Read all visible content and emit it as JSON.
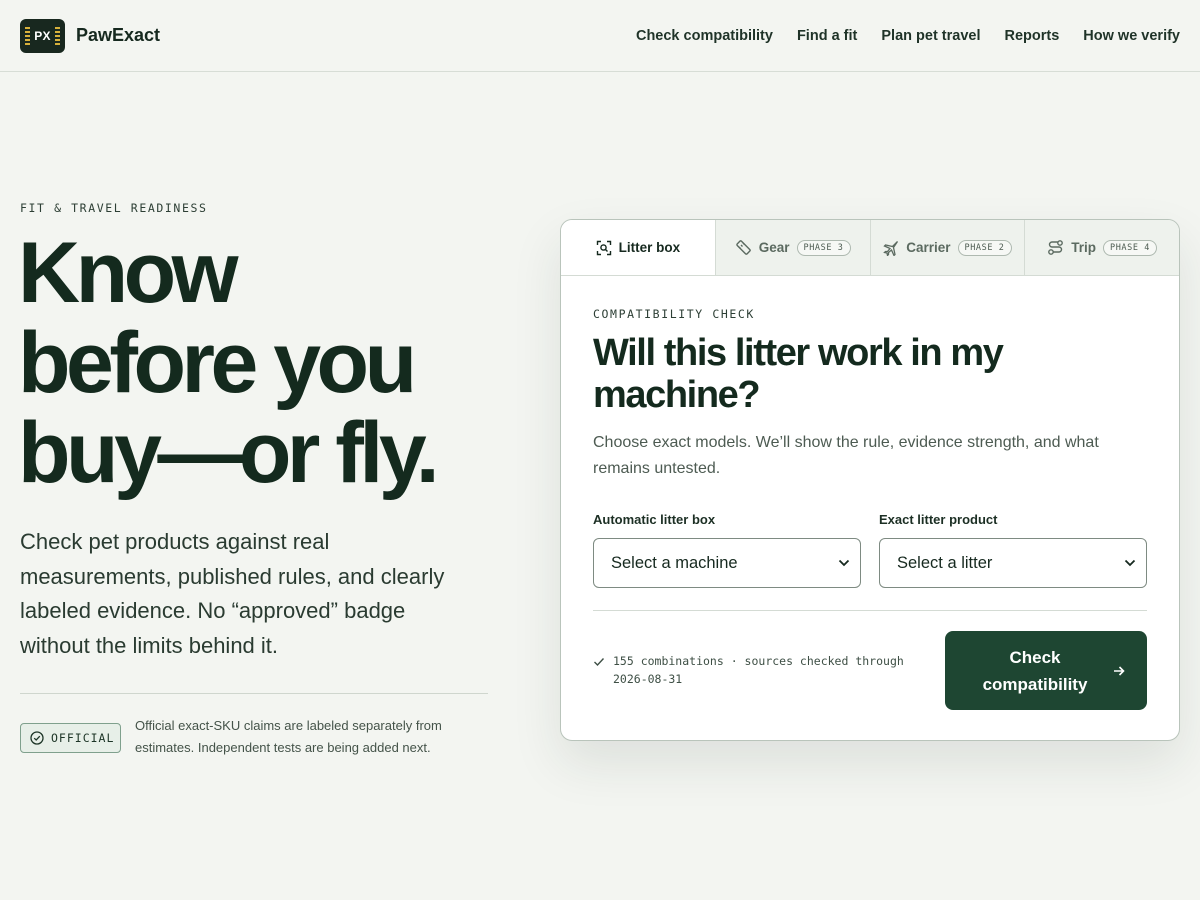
{
  "header": {
    "logo_text": "PX",
    "brand": "PawExact",
    "nav": [
      "Check compatibility",
      "Find a fit",
      "Plan pet travel",
      "Reports",
      "How we verify"
    ]
  },
  "hero": {
    "eyebrow": "FIT & TRAVEL READINESS",
    "title_lines": [
      "Know",
      "before you",
      "buy—or fly."
    ],
    "subtitle": "Check pet products against real measurements, published rules, and clearly labeled evidence. No “approved” badge without the limits behind it.",
    "badge": "OFFICIAL",
    "badge_note": "Official exact-SKU claims are labeled separately from estimates. Independent tests are being added next."
  },
  "card": {
    "tabs": [
      {
        "label": "Litter box",
        "phase": "",
        "icon": "scan-icon",
        "active": true
      },
      {
        "label": "Gear",
        "phase": "PHASE 3",
        "icon": "ruler-icon",
        "active": false
      },
      {
        "label": "Carrier",
        "phase": "PHASE 2",
        "icon": "plane-icon",
        "active": false
      },
      {
        "label": "Trip",
        "phase": "PHASE 4",
        "icon": "route-icon",
        "active": false
      }
    ],
    "eyebrow": "COMPATIBILITY CHECK",
    "title": "Will this litter work in my machine?",
    "description": "Choose exact models. We’ll show the rule, evidence strength, and what remains untested.",
    "machine_label": "Automatic litter box",
    "machine_value": "Select a machine",
    "litter_label": "Exact litter product",
    "litter_value": "Select a litter",
    "status": "155 combinations · sources checked through 2026-08-31",
    "cta": "Check compatibility"
  },
  "colors": {
    "background": "#f3f5f1",
    "ink": "#142a1e",
    "cta": "#1e4632",
    "badge_border": "#7fa08d"
  }
}
